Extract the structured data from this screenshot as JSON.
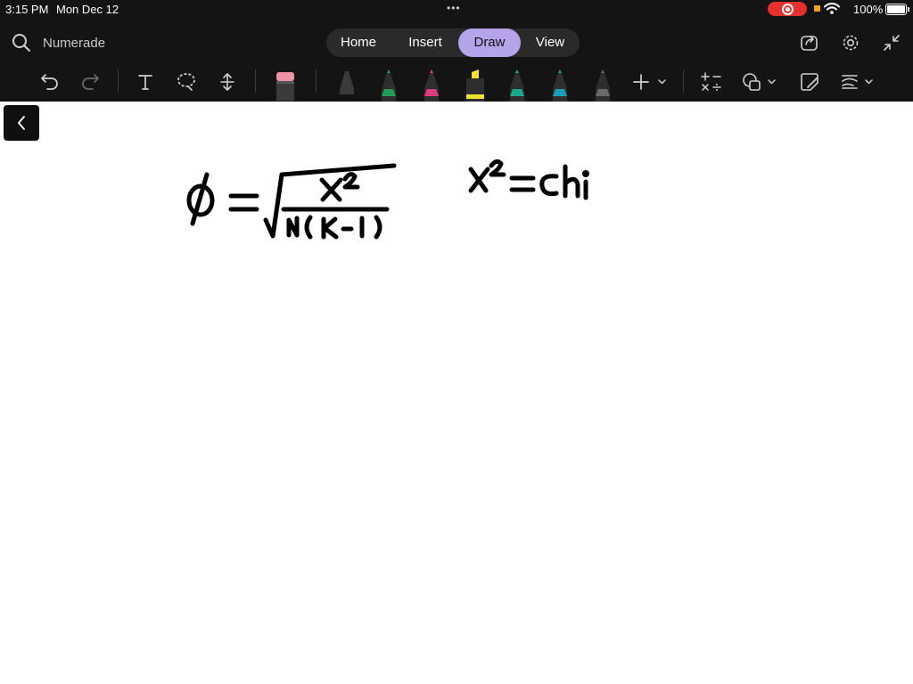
{
  "status_bar": {
    "time": "3:15 PM",
    "date": "Mon Dec 12",
    "battery": "100%"
  },
  "header": {
    "app_name": "Numerade",
    "tabs": [
      {
        "label": "Home"
      },
      {
        "label": "Insert"
      },
      {
        "label": "Draw",
        "active": true
      },
      {
        "label": "View"
      }
    ]
  },
  "colors": {
    "background": "#141414",
    "accent": "#b6a4ea",
    "pens": [
      "#141414",
      "#1e9f55",
      "#e03b7b",
      "#f2e22b",
      "#19a98f",
      "#1aa0b5",
      "#6a6a6a"
    ]
  },
  "toolbar": {
    "icons": [
      "undo-icon",
      "redo-icon",
      "text-icon",
      "lasso-icon",
      "insert-space-icon",
      "eraser-icon",
      "pen-black-icon",
      "pen-green-icon",
      "pen-pink-icon",
      "highlighter-yellow-icon",
      "pen-teal-icon",
      "pen-cyan-icon",
      "pen-gray-icon",
      "add-pen-icon",
      "math-icon",
      "shapes-icon",
      "ink-to-shape-icon",
      "line-style-icon"
    ]
  },
  "canvas": {
    "handwriting": [
      "ϕ = √( χ² / N(k−1) )",
      "χ² = chi"
    ]
  }
}
